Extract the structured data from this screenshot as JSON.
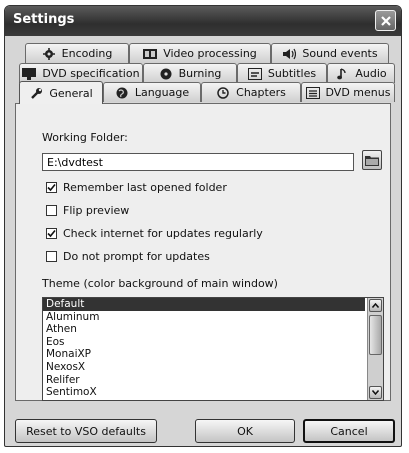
{
  "window": {
    "title": "Settings"
  },
  "tabs": {
    "row1": [
      {
        "label": "Encoding",
        "icon": "gear-icon"
      },
      {
        "label": "Video processing",
        "icon": "film-icon"
      },
      {
        "label": "Sound events",
        "icon": "speaker-icon"
      }
    ],
    "row2": [
      {
        "label": "DVD specification",
        "icon": "monitor-icon"
      },
      {
        "label": "Burning",
        "icon": "disc-icon"
      },
      {
        "label": "Subtitles",
        "icon": "subtitle-icon"
      },
      {
        "label": "Audio",
        "icon": "music-note-icon"
      }
    ],
    "row3": [
      {
        "label": "General",
        "icon": "wrench-icon",
        "active": true
      },
      {
        "label": "Language",
        "icon": "globe-icon"
      },
      {
        "label": "Chapters",
        "icon": "clock-icon"
      },
      {
        "label": "DVD menus",
        "icon": "menu-icon"
      }
    ]
  },
  "general": {
    "working_folder_label": "Working Folder:",
    "working_folder_value": "E:\\dvdtest",
    "options": [
      {
        "label": "Remember last opened folder",
        "checked": true
      },
      {
        "label": "Flip preview",
        "checked": false
      },
      {
        "label": "Check internet for updates regularly",
        "checked": true
      },
      {
        "label": "Do not prompt for updates",
        "checked": false
      }
    ],
    "theme_label": "Theme (color background of main window)",
    "themes": [
      "Default",
      "Aluminum",
      "Athen",
      "Eos",
      "MonaiXP",
      "NexosX",
      "Relifer",
      "SentimoX"
    ],
    "selected_theme": "Default"
  },
  "buttons": {
    "reset": "Reset to VSO defaults",
    "ok": "OK",
    "cancel": "Cancel"
  }
}
